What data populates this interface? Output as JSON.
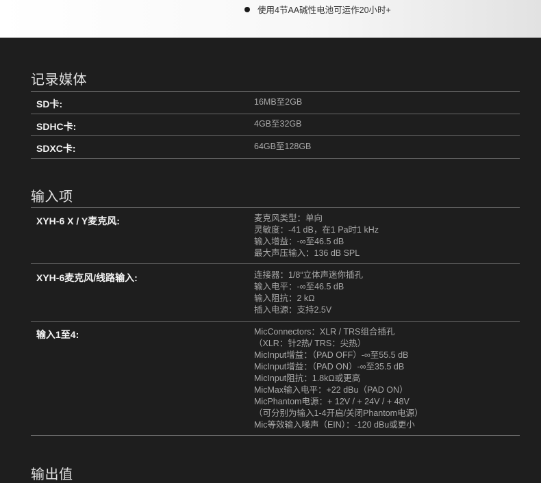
{
  "top_bullet": "使用4节AA碱性电池可运作20小时+",
  "recording_media": {
    "title": "记录媒体",
    "rows": [
      {
        "label": "SD卡:",
        "value": "16MB至2GB"
      },
      {
        "label": "SDHC卡:",
        "value": "4GB至32GB"
      },
      {
        "label": "SDXC卡:",
        "value": "64GB至128GB"
      }
    ]
  },
  "inputs": {
    "title": "输入项",
    "rows": [
      {
        "label": "XYH-6 X / Y麦克风:",
        "lines": [
          "麦克风类型：单向",
          "灵敏度：-41 dB，在1 Pa时1 kHz",
          "输入增益：-∞至46.5 dB",
          "最大声压输入：136 dB SPL"
        ]
      },
      {
        "label": "XYH-6麦克风/线路输入:",
        "lines": [
          "连接器：1/8“立体声迷你插孔",
          "输入电平：-∞至46.5 dB",
          "输入阻抗：2 kΩ",
          "插入电源：支持2.5V"
        ]
      },
      {
        "label": "输入1至4:",
        "lines": [
          "MicConnectors：XLR / TRS组合插孔",
          "（XLR：针2热/ TRS：尖热）",
          "MicInput增益：（PAD OFF）-∞至55.5 dB",
          "MicInput增益：（PAD ON）-∞至35.5 dB",
          "MicInput阻抗：1.8kΩ或更高",
          "MicMax输入电平：+22 dBu（PAD ON）",
          "MicPhantom电源：+ 12V / + 24V / + 48V",
          "（可分别为输入1-4开启/关闭Phantom电源）",
          "Mic等效输入噪声（EIN）：-120 dBu或更小"
        ]
      }
    ]
  },
  "outputs": {
    "title": "输出值"
  }
}
